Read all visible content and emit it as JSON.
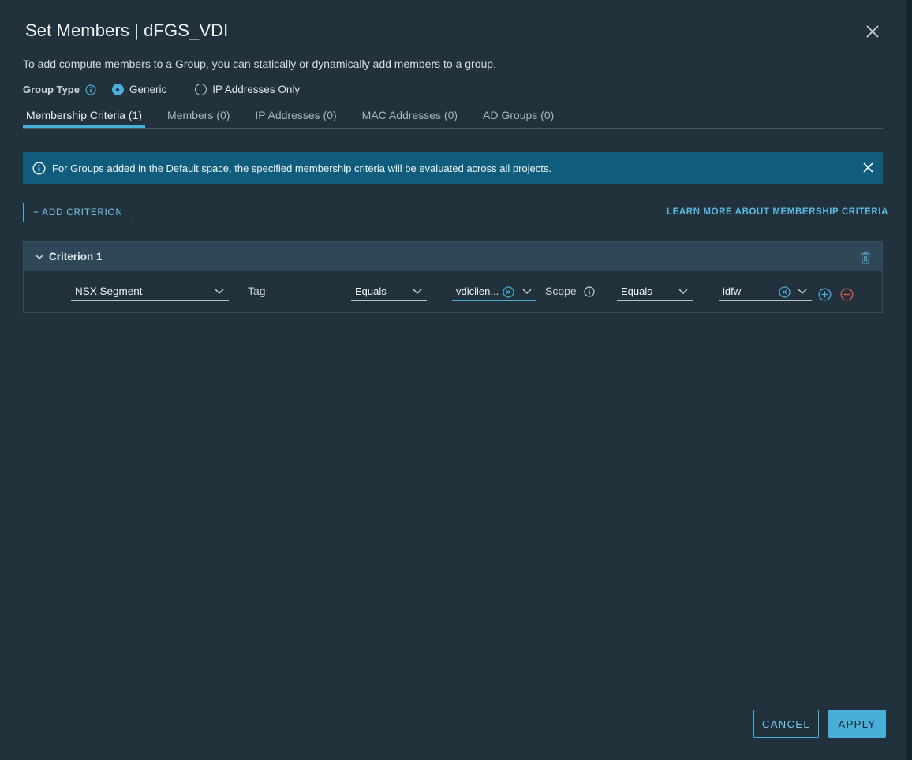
{
  "dialog": {
    "title": "Set Members | dFGS_VDI",
    "description": "To add compute members to a Group, you can statically or dynamically add members to a group.",
    "close_icon": "close-icon"
  },
  "group_type": {
    "label": "Group Type",
    "options": [
      {
        "label": "Generic",
        "selected": true
      },
      {
        "label": "IP Addresses Only",
        "selected": false
      }
    ]
  },
  "tabs": [
    {
      "label": "Membership Criteria (1)",
      "active": true
    },
    {
      "label": "Members (0)",
      "active": false
    },
    {
      "label": "IP Addresses (0)",
      "active": false
    },
    {
      "label": "MAC Addresses (0)",
      "active": false
    },
    {
      "label": "AD Groups (0)",
      "active": false
    }
  ],
  "banner": {
    "text": "For Groups added in the Default space, the specified membership criteria will be evaluated across all projects."
  },
  "actions": {
    "add_criterion": "+ ADD CRITERION",
    "learn_more": "LEARN MORE ABOUT MEMBERSHIP CRITERIA"
  },
  "criterion": {
    "title": "Criterion 1",
    "member_type": "NSX Segment",
    "tag_label": "Tag",
    "tag_operator": "Equals",
    "tag_value": "vdiclien...",
    "scope_label": "Scope",
    "scope_operator": "Equals",
    "scope_value": "idfw"
  },
  "footer": {
    "cancel": "CANCEL",
    "apply": "APPLY"
  },
  "colors": {
    "accent": "#49afd9",
    "background": "#21323c",
    "banner": "#0f5c7d",
    "danger": "#e05a4b"
  }
}
